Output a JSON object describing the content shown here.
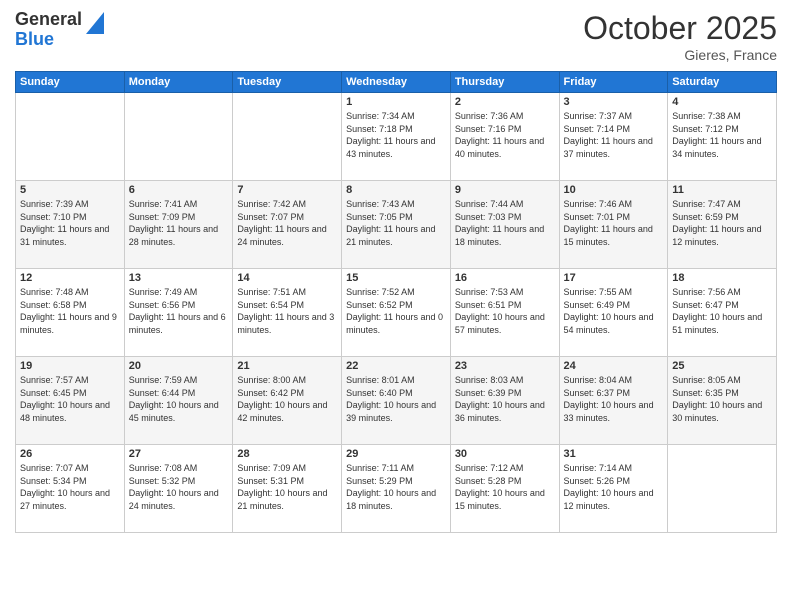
{
  "header": {
    "logo_line1": "General",
    "logo_line2": "Blue",
    "month_title": "October 2025",
    "location": "Gieres, France"
  },
  "days_of_week": [
    "Sunday",
    "Monday",
    "Tuesday",
    "Wednesday",
    "Thursday",
    "Friday",
    "Saturday"
  ],
  "weeks": [
    [
      {
        "num": "",
        "sunrise": "",
        "sunset": "",
        "daylight": ""
      },
      {
        "num": "",
        "sunrise": "",
        "sunset": "",
        "daylight": ""
      },
      {
        "num": "",
        "sunrise": "",
        "sunset": "",
        "daylight": ""
      },
      {
        "num": "1",
        "sunrise": "Sunrise: 7:34 AM",
        "sunset": "Sunset: 7:18 PM",
        "daylight": "Daylight: 11 hours and 43 minutes."
      },
      {
        "num": "2",
        "sunrise": "Sunrise: 7:36 AM",
        "sunset": "Sunset: 7:16 PM",
        "daylight": "Daylight: 11 hours and 40 minutes."
      },
      {
        "num": "3",
        "sunrise": "Sunrise: 7:37 AM",
        "sunset": "Sunset: 7:14 PM",
        "daylight": "Daylight: 11 hours and 37 minutes."
      },
      {
        "num": "4",
        "sunrise": "Sunrise: 7:38 AM",
        "sunset": "Sunset: 7:12 PM",
        "daylight": "Daylight: 11 hours and 34 minutes."
      }
    ],
    [
      {
        "num": "5",
        "sunrise": "Sunrise: 7:39 AM",
        "sunset": "Sunset: 7:10 PM",
        "daylight": "Daylight: 11 hours and 31 minutes."
      },
      {
        "num": "6",
        "sunrise": "Sunrise: 7:41 AM",
        "sunset": "Sunset: 7:09 PM",
        "daylight": "Daylight: 11 hours and 28 minutes."
      },
      {
        "num": "7",
        "sunrise": "Sunrise: 7:42 AM",
        "sunset": "Sunset: 7:07 PM",
        "daylight": "Daylight: 11 hours and 24 minutes."
      },
      {
        "num": "8",
        "sunrise": "Sunrise: 7:43 AM",
        "sunset": "Sunset: 7:05 PM",
        "daylight": "Daylight: 11 hours and 21 minutes."
      },
      {
        "num": "9",
        "sunrise": "Sunrise: 7:44 AM",
        "sunset": "Sunset: 7:03 PM",
        "daylight": "Daylight: 11 hours and 18 minutes."
      },
      {
        "num": "10",
        "sunrise": "Sunrise: 7:46 AM",
        "sunset": "Sunset: 7:01 PM",
        "daylight": "Daylight: 11 hours and 15 minutes."
      },
      {
        "num": "11",
        "sunrise": "Sunrise: 7:47 AM",
        "sunset": "Sunset: 6:59 PM",
        "daylight": "Daylight: 11 hours and 12 minutes."
      }
    ],
    [
      {
        "num": "12",
        "sunrise": "Sunrise: 7:48 AM",
        "sunset": "Sunset: 6:58 PM",
        "daylight": "Daylight: 11 hours and 9 minutes."
      },
      {
        "num": "13",
        "sunrise": "Sunrise: 7:49 AM",
        "sunset": "Sunset: 6:56 PM",
        "daylight": "Daylight: 11 hours and 6 minutes."
      },
      {
        "num": "14",
        "sunrise": "Sunrise: 7:51 AM",
        "sunset": "Sunset: 6:54 PM",
        "daylight": "Daylight: 11 hours and 3 minutes."
      },
      {
        "num": "15",
        "sunrise": "Sunrise: 7:52 AM",
        "sunset": "Sunset: 6:52 PM",
        "daylight": "Daylight: 11 hours and 0 minutes."
      },
      {
        "num": "16",
        "sunrise": "Sunrise: 7:53 AM",
        "sunset": "Sunset: 6:51 PM",
        "daylight": "Daylight: 10 hours and 57 minutes."
      },
      {
        "num": "17",
        "sunrise": "Sunrise: 7:55 AM",
        "sunset": "Sunset: 6:49 PM",
        "daylight": "Daylight: 10 hours and 54 minutes."
      },
      {
        "num": "18",
        "sunrise": "Sunrise: 7:56 AM",
        "sunset": "Sunset: 6:47 PM",
        "daylight": "Daylight: 10 hours and 51 minutes."
      }
    ],
    [
      {
        "num": "19",
        "sunrise": "Sunrise: 7:57 AM",
        "sunset": "Sunset: 6:45 PM",
        "daylight": "Daylight: 10 hours and 48 minutes."
      },
      {
        "num": "20",
        "sunrise": "Sunrise: 7:59 AM",
        "sunset": "Sunset: 6:44 PM",
        "daylight": "Daylight: 10 hours and 45 minutes."
      },
      {
        "num": "21",
        "sunrise": "Sunrise: 8:00 AM",
        "sunset": "Sunset: 6:42 PM",
        "daylight": "Daylight: 10 hours and 42 minutes."
      },
      {
        "num": "22",
        "sunrise": "Sunrise: 8:01 AM",
        "sunset": "Sunset: 6:40 PM",
        "daylight": "Daylight: 10 hours and 39 minutes."
      },
      {
        "num": "23",
        "sunrise": "Sunrise: 8:03 AM",
        "sunset": "Sunset: 6:39 PM",
        "daylight": "Daylight: 10 hours and 36 minutes."
      },
      {
        "num": "24",
        "sunrise": "Sunrise: 8:04 AM",
        "sunset": "Sunset: 6:37 PM",
        "daylight": "Daylight: 10 hours and 33 minutes."
      },
      {
        "num": "25",
        "sunrise": "Sunrise: 8:05 AM",
        "sunset": "Sunset: 6:35 PM",
        "daylight": "Daylight: 10 hours and 30 minutes."
      }
    ],
    [
      {
        "num": "26",
        "sunrise": "Sunrise: 7:07 AM",
        "sunset": "Sunset: 5:34 PM",
        "daylight": "Daylight: 10 hours and 27 minutes."
      },
      {
        "num": "27",
        "sunrise": "Sunrise: 7:08 AM",
        "sunset": "Sunset: 5:32 PM",
        "daylight": "Daylight: 10 hours and 24 minutes."
      },
      {
        "num": "28",
        "sunrise": "Sunrise: 7:09 AM",
        "sunset": "Sunset: 5:31 PM",
        "daylight": "Daylight: 10 hours and 21 minutes."
      },
      {
        "num": "29",
        "sunrise": "Sunrise: 7:11 AM",
        "sunset": "Sunset: 5:29 PM",
        "daylight": "Daylight: 10 hours and 18 minutes."
      },
      {
        "num": "30",
        "sunrise": "Sunrise: 7:12 AM",
        "sunset": "Sunset: 5:28 PM",
        "daylight": "Daylight: 10 hours and 15 minutes."
      },
      {
        "num": "31",
        "sunrise": "Sunrise: 7:14 AM",
        "sunset": "Sunset: 5:26 PM",
        "daylight": "Daylight: 10 hours and 12 minutes."
      },
      {
        "num": "",
        "sunrise": "",
        "sunset": "",
        "daylight": ""
      }
    ]
  ]
}
